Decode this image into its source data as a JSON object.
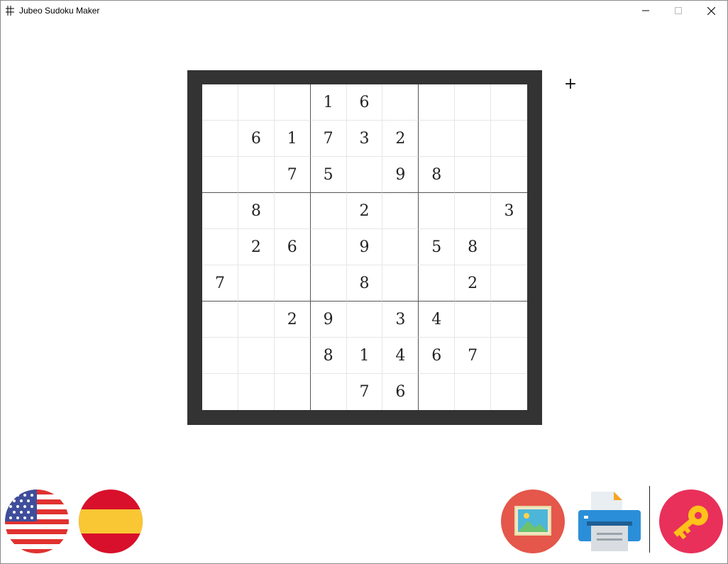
{
  "window": {
    "title": "Jubeo Sudoku Maker",
    "minimize_label": "—",
    "maximize_label": "☐",
    "close_label": "✕"
  },
  "board": {
    "rows": [
      [
        "",
        "",
        "",
        "1",
        "6",
        "",
        "",
        "",
        ""
      ],
      [
        "",
        "6",
        "1",
        "7",
        "3",
        "2",
        "",
        "",
        ""
      ],
      [
        "",
        "",
        "7",
        "5",
        "",
        "9",
        "8",
        "",
        ""
      ],
      [
        "",
        "8",
        "",
        "",
        "2",
        "",
        "",
        "",
        "3"
      ],
      [
        "",
        "2",
        "6",
        "",
        "9",
        "",
        "5",
        "8",
        ""
      ],
      [
        "7",
        "",
        "",
        "",
        "8",
        "",
        "",
        "2",
        ""
      ],
      [
        "",
        "",
        "2",
        "9",
        "",
        "3",
        "4",
        "",
        ""
      ],
      [
        "",
        "",
        "",
        "8",
        "1",
        "4",
        "6",
        "7",
        ""
      ],
      [
        "",
        "",
        "",
        "",
        "7",
        "6",
        "",
        "",
        ""
      ]
    ]
  },
  "controls": {
    "plus_label": "+"
  },
  "colors": {
    "board_frame": "#333333",
    "image_button": "#e4574a",
    "key_button": "#e8305a",
    "printer_body": "#2a8fd8"
  },
  "icons": {
    "us_flag": "us-flag-icon",
    "es_flag": "spain-flag-icon",
    "image": "image-icon",
    "printer": "printer-icon",
    "key": "key-icon"
  }
}
